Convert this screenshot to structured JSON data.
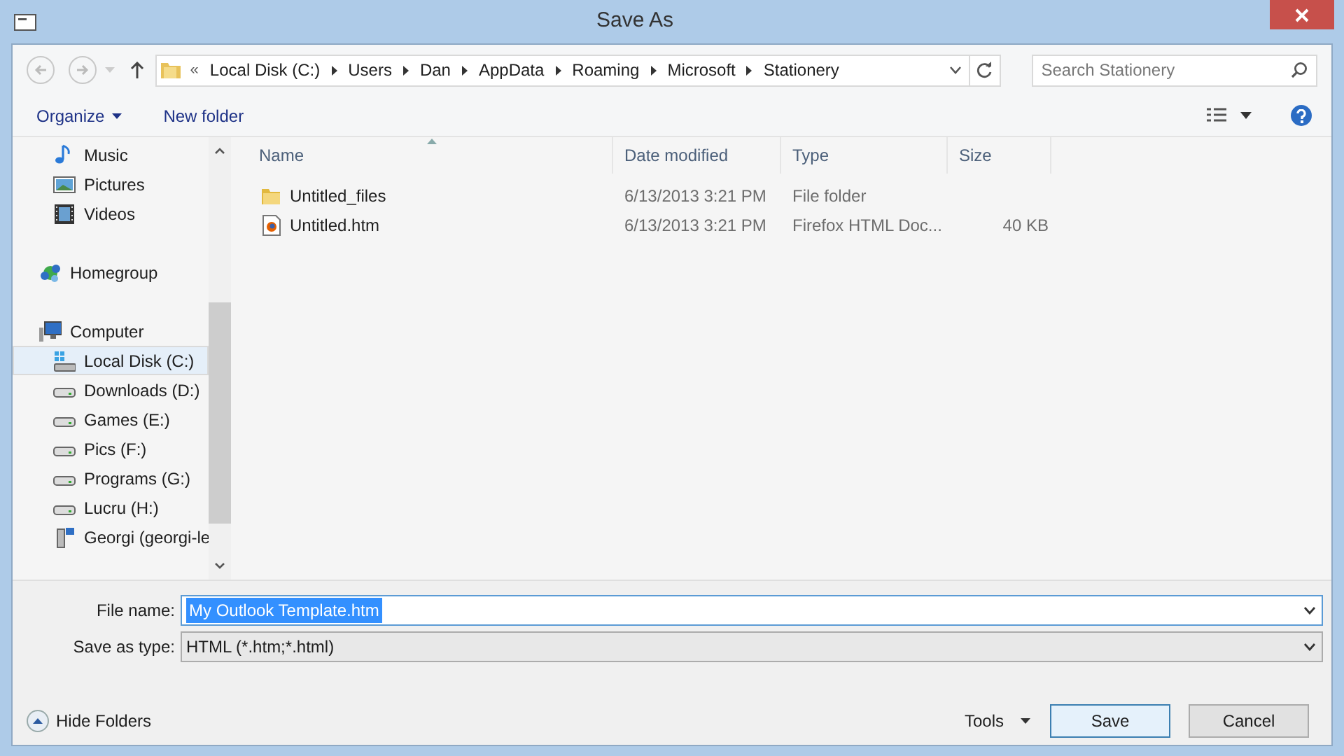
{
  "window": {
    "title": "Save As"
  },
  "address": {
    "prefix": "«",
    "crumbs": [
      "Local Disk (C:)",
      "Users",
      "Dan",
      "AppData",
      "Roaming",
      "Microsoft",
      "Stationery"
    ]
  },
  "search": {
    "placeholder": "Search Stationery"
  },
  "toolbar": {
    "organize": "Organize",
    "new_folder": "New folder"
  },
  "sidebar": {
    "libraries": [
      {
        "label": "Music",
        "kind": "music",
        "selected": false
      },
      {
        "label": "Pictures",
        "kind": "pictures",
        "selected": false
      },
      {
        "label": "Videos",
        "kind": "videos",
        "selected": false
      }
    ],
    "nodes": [
      {
        "label": "Homegroup",
        "kind": "homegroup",
        "selected": false
      },
      {
        "label": "Computer",
        "kind": "computer",
        "selected": false,
        "children": [
          {
            "label": "Local Disk (C:)",
            "kind": "system_drive",
            "selected": true
          },
          {
            "label": "Downloads (D:)",
            "kind": "drive",
            "selected": false
          },
          {
            "label": "Games (E:)",
            "kind": "drive",
            "selected": false
          },
          {
            "label": "Pics (F:)",
            "kind": "drive",
            "selected": false
          },
          {
            "label": "Programs (G:)",
            "kind": "drive",
            "selected": false
          },
          {
            "label": "Lucru (H:)",
            "kind": "drive",
            "selected": false
          },
          {
            "label": "Georgi (georgi-le",
            "kind": "network",
            "selected": false
          }
        ]
      }
    ]
  },
  "columns": [
    "Name",
    "Date modified",
    "Type",
    "Size"
  ],
  "files": [
    {
      "name": "Untitled_files",
      "kind": "folder",
      "date": "6/13/2013 3:21 PM",
      "type": "File folder"
    },
    {
      "name": "Untitled.htm",
      "kind": "html",
      "date": "6/13/2013 3:21 PM",
      "type": "Firefox HTML Doc...",
      "size": "40 KB"
    }
  ],
  "file_name": {
    "label": "File name:",
    "value": "My Outlook Template.htm"
  },
  "save_type": {
    "label": "Save as type:",
    "value": "HTML (*.htm;*.html)"
  },
  "hide_folders": "Hide Folders",
  "tools": "Tools",
  "buttons": {
    "save": "Save",
    "cancel": "Cancel"
  }
}
